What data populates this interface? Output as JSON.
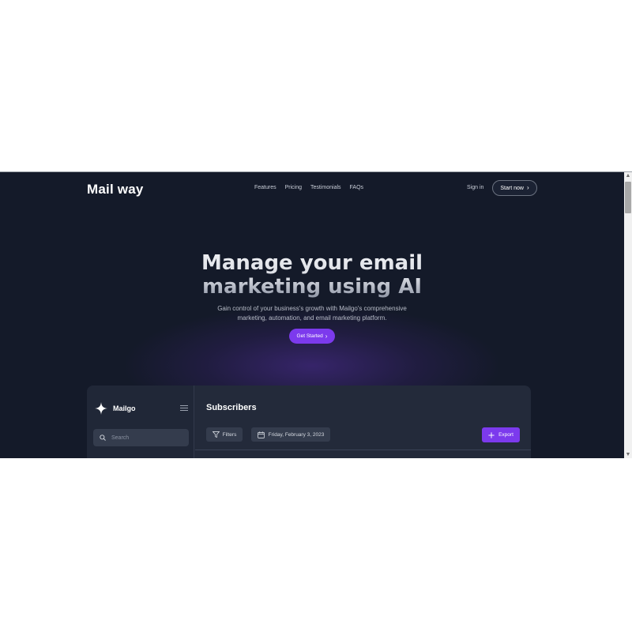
{
  "nav": {
    "logo": "Mail way",
    "links": [
      "Features",
      "Pricing",
      "Testimonials",
      "FAQs"
    ],
    "sign_in": "Sign in",
    "start_now": "Start now"
  },
  "hero": {
    "title_line1": "Manage your email",
    "title_line2": "marketing using AI",
    "subtitle_line1": "Gain control of your business's growth with Mailgo's comprehensive",
    "subtitle_line2": "marketing, automation, and email marketing platform.",
    "cta": "Get Started"
  },
  "dashboard": {
    "brand": "Mailgo",
    "search_placeholder": "Search",
    "title": "Subscribers",
    "filters_label": "Filters",
    "date_label": "Friday, February 3, 2023",
    "export_label": "Export"
  },
  "colors": {
    "background": "#141a29",
    "accent": "#7c3aed",
    "panel": "#232a3a"
  },
  "icons": [
    "chevron-right-icon",
    "sparkle-icon",
    "menu-icon",
    "search-icon",
    "filter-icon",
    "calendar-icon",
    "plus-icon"
  ]
}
